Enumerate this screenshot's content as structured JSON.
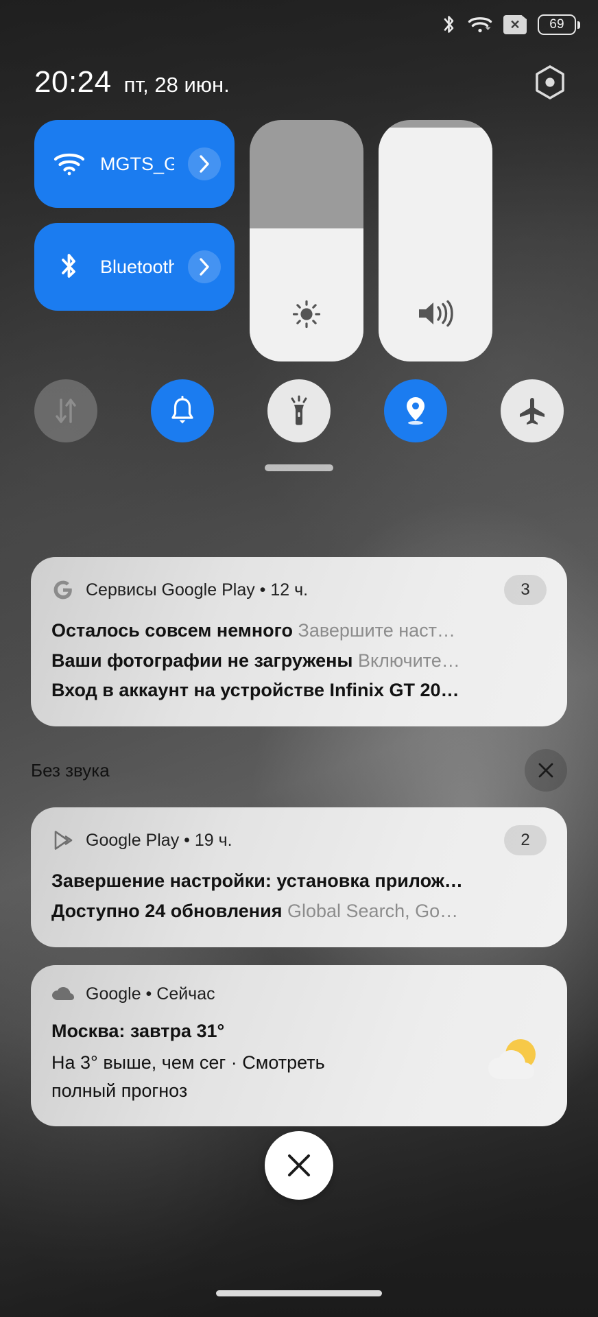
{
  "status_bar": {
    "bluetooth_icon": "bluetooth-icon",
    "wifi_icon": "wifi-icon",
    "sim_icon": "sim-card-disabled-icon",
    "battery_level": "69"
  },
  "header": {
    "time": "20:24",
    "date": "пт, 28 июн.",
    "settings_icon": "settings-gear-icon"
  },
  "quick_settings": {
    "tiles": [
      {
        "id": "wifi",
        "label": "MGTS_G..",
        "icon": "wifi-icon",
        "state": "on",
        "chevron": "›"
      },
      {
        "id": "bluetooth",
        "label": "Bluetooth",
        "icon": "bluetooth-icon",
        "state": "on",
        "chevron": "›"
      }
    ],
    "sliders": [
      {
        "id": "brightness",
        "icon": "brightness-icon",
        "value": 55
      },
      {
        "id": "volume",
        "icon": "volume-icon",
        "value": 97
      }
    ],
    "toggles": [
      {
        "id": "mobile-data",
        "icon": "mobile-data-icon",
        "state": "disabled"
      },
      {
        "id": "ringer-silent",
        "icon": "bell-icon",
        "state": "on"
      },
      {
        "id": "flashlight",
        "icon": "flashlight-icon",
        "state": "off"
      },
      {
        "id": "location",
        "icon": "location-pin-icon",
        "state": "on"
      },
      {
        "id": "airplane-mode",
        "icon": "airplane-icon",
        "state": "off"
      }
    ]
  },
  "notifications": {
    "primary": {
      "app": "Сервисы Google Play",
      "separator": "•",
      "time": "12 ч.",
      "count": "3",
      "icon": "google-g-icon",
      "lines": [
        {
          "title": "Осталось совсем немного",
          "body": "Завершите наст…"
        },
        {
          "title": "Ваши фотографии не загружены",
          "body": "Включите…"
        },
        {
          "title": "Вход в аккаунт на устройстве Infinix GT 20…",
          "body": ""
        }
      ]
    },
    "silent_section": {
      "label": "Без звука",
      "clear_icon": "close-x-icon"
    },
    "silent": [
      {
        "app": "Google Play",
        "separator": "•",
        "time": "19 ч.",
        "count": "2",
        "icon": "google-play-icon",
        "lines": [
          {
            "title": "Завершение настройки: установка прилож…",
            "body": ""
          },
          {
            "title": "Доступно 24 обновления",
            "body": "Global Search, Go…"
          }
        ]
      }
    ],
    "weather": {
      "app": "Google",
      "separator": "•",
      "time": "Сейчас",
      "icon": "cloud-icon",
      "title": "Москва: завтра 31°",
      "body_line_1": "На 3° выше, чем сег       · Смотреть",
      "body_line_2": "полный прогноз",
      "weather_icon": "sun-behind-cloud-icon"
    },
    "clear_all_icon": "close-x-icon"
  },
  "nav_bar": {
    "pill": "home-gesture-pill"
  },
  "colors": {
    "accent_blue": "#1b7cf0",
    "tile_off": "#e8e8e8",
    "slider_track": "#9b9b9b",
    "slider_fill": "#f1f1f1",
    "card_bg": "#e9e9e9"
  }
}
